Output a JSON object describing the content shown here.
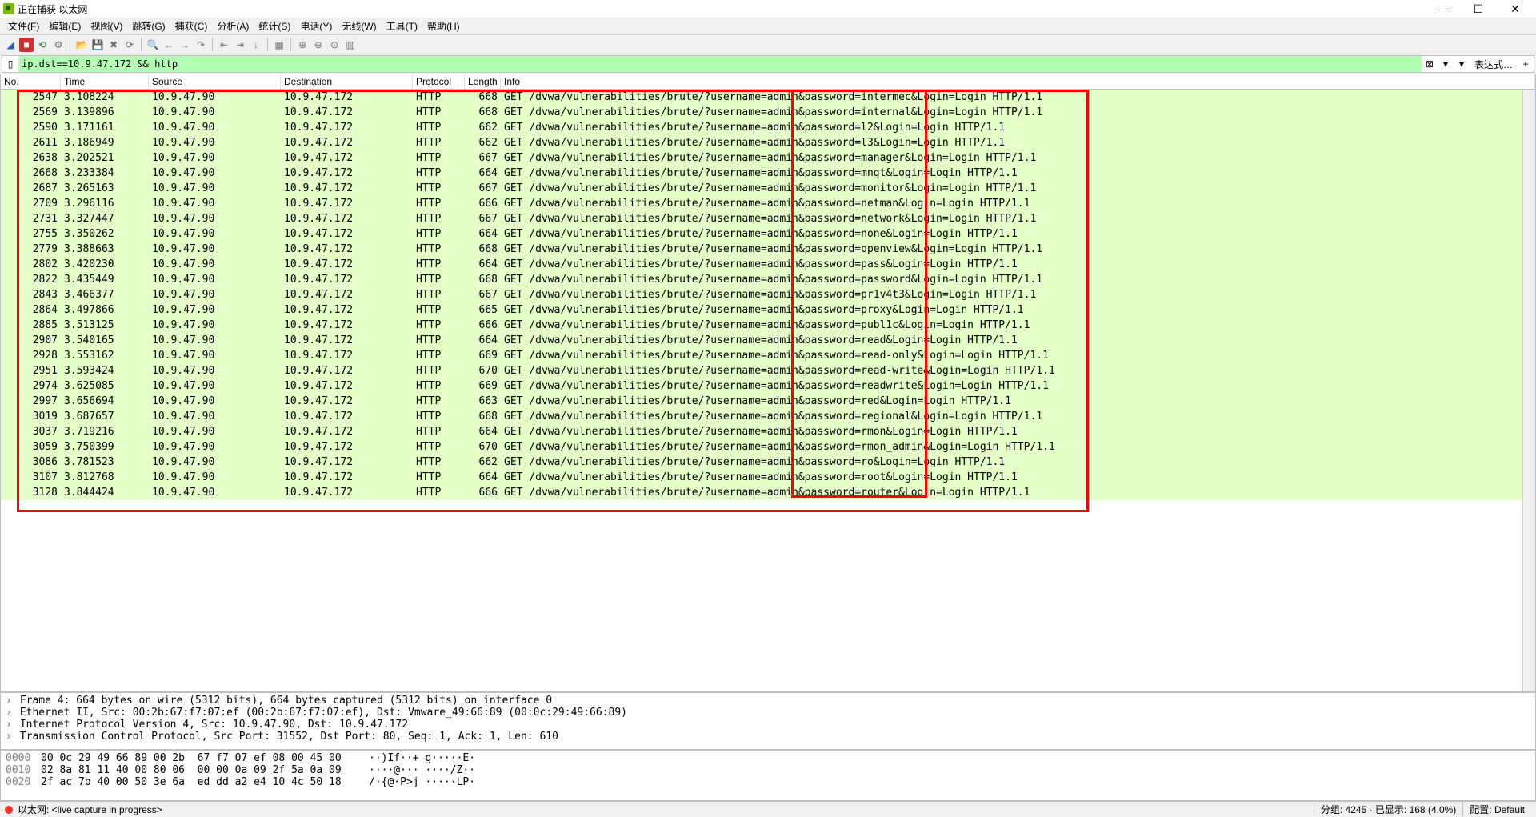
{
  "window": {
    "title": "正在捕获 以太网"
  },
  "menu": {
    "file": "文件(F)",
    "edit": "编辑(E)",
    "view": "视图(V)",
    "go": "跳转(G)",
    "capture": "捕获(C)",
    "analyze": "分析(A)",
    "stats": "统计(S)",
    "telephony": "电话(Y)",
    "wireless": "无线(W)",
    "tools": "工具(T)",
    "help": "帮助(H)"
  },
  "filter": {
    "value": "ip.dst==10.9.47.172 && http",
    "expr": "表达式…",
    "plus": "+"
  },
  "columns": {
    "no": "No.",
    "time": "Time",
    "source": "Source",
    "dest": "Destination",
    "proto": "Protocol",
    "len": "Length",
    "info": "Info"
  },
  "col_widths": {
    "no": 75,
    "time": 110,
    "source": 165,
    "dest": 165,
    "proto": 65,
    "len": 45,
    "info": 880
  },
  "packets": [
    {
      "no": "2547",
      "time": "3.108224",
      "src": "10.9.47.90",
      "dst": "10.9.47.172",
      "proto": "HTTP",
      "len": "668",
      "info": "GET /dvwa/vulnerabilities/brute/?username=admin&password=intermec&Login=Login HTTP/1.1"
    },
    {
      "no": "2569",
      "time": "3.139896",
      "src": "10.9.47.90",
      "dst": "10.9.47.172",
      "proto": "HTTP",
      "len": "668",
      "info": "GET /dvwa/vulnerabilities/brute/?username=admin&password=internal&Login=Login HTTP/1.1"
    },
    {
      "no": "2590",
      "time": "3.171161",
      "src": "10.9.47.90",
      "dst": "10.9.47.172",
      "proto": "HTTP",
      "len": "662",
      "info": "GET /dvwa/vulnerabilities/brute/?username=admin&password=l2&Login=Login HTTP/1.1"
    },
    {
      "no": "2611",
      "time": "3.186949",
      "src": "10.9.47.90",
      "dst": "10.9.47.172",
      "proto": "HTTP",
      "len": "662",
      "info": "GET /dvwa/vulnerabilities/brute/?username=admin&password=l3&Login=Login HTTP/1.1"
    },
    {
      "no": "2638",
      "time": "3.202521",
      "src": "10.9.47.90",
      "dst": "10.9.47.172",
      "proto": "HTTP",
      "len": "667",
      "info": "GET /dvwa/vulnerabilities/brute/?username=admin&password=manager&Login=Login HTTP/1.1"
    },
    {
      "no": "2668",
      "time": "3.233384",
      "src": "10.9.47.90",
      "dst": "10.9.47.172",
      "proto": "HTTP",
      "len": "664",
      "info": "GET /dvwa/vulnerabilities/brute/?username=admin&password=mngt&Login=Login HTTP/1.1"
    },
    {
      "no": "2687",
      "time": "3.265163",
      "src": "10.9.47.90",
      "dst": "10.9.47.172",
      "proto": "HTTP",
      "len": "667",
      "info": "GET /dvwa/vulnerabilities/brute/?username=admin&password=monitor&Login=Login HTTP/1.1"
    },
    {
      "no": "2709",
      "time": "3.296116",
      "src": "10.9.47.90",
      "dst": "10.9.47.172",
      "proto": "HTTP",
      "len": "666",
      "info": "GET /dvwa/vulnerabilities/brute/?username=admin&password=netman&Login=Login HTTP/1.1"
    },
    {
      "no": "2731",
      "time": "3.327447",
      "src": "10.9.47.90",
      "dst": "10.9.47.172",
      "proto": "HTTP",
      "len": "667",
      "info": "GET /dvwa/vulnerabilities/brute/?username=admin&password=network&Login=Login HTTP/1.1"
    },
    {
      "no": "2755",
      "time": "3.350262",
      "src": "10.9.47.90",
      "dst": "10.9.47.172",
      "proto": "HTTP",
      "len": "664",
      "info": "GET /dvwa/vulnerabilities/brute/?username=admin&password=none&Login=Login HTTP/1.1"
    },
    {
      "no": "2779",
      "time": "3.388663",
      "src": "10.9.47.90",
      "dst": "10.9.47.172",
      "proto": "HTTP",
      "len": "668",
      "info": "GET /dvwa/vulnerabilities/brute/?username=admin&password=openview&Login=Login HTTP/1.1"
    },
    {
      "no": "2802",
      "time": "3.420230",
      "src": "10.9.47.90",
      "dst": "10.9.47.172",
      "proto": "HTTP",
      "len": "664",
      "info": "GET /dvwa/vulnerabilities/brute/?username=admin&password=pass&Login=Login HTTP/1.1"
    },
    {
      "no": "2822",
      "time": "3.435449",
      "src": "10.9.47.90",
      "dst": "10.9.47.172",
      "proto": "HTTP",
      "len": "668",
      "info": "GET /dvwa/vulnerabilities/brute/?username=admin&password=password&Login=Login HTTP/1.1"
    },
    {
      "no": "2843",
      "time": "3.466377",
      "src": "10.9.47.90",
      "dst": "10.9.47.172",
      "proto": "HTTP",
      "len": "667",
      "info": "GET /dvwa/vulnerabilities/brute/?username=admin&password=pr1v4t3&Login=Login HTTP/1.1"
    },
    {
      "no": "2864",
      "time": "3.497866",
      "src": "10.9.47.90",
      "dst": "10.9.47.172",
      "proto": "HTTP",
      "len": "665",
      "info": "GET /dvwa/vulnerabilities/brute/?username=admin&password=proxy&Login=Login HTTP/1.1"
    },
    {
      "no": "2885",
      "time": "3.513125",
      "src": "10.9.47.90",
      "dst": "10.9.47.172",
      "proto": "HTTP",
      "len": "666",
      "info": "GET /dvwa/vulnerabilities/brute/?username=admin&password=publ1c&Login=Login HTTP/1.1"
    },
    {
      "no": "2907",
      "time": "3.540165",
      "src": "10.9.47.90",
      "dst": "10.9.47.172",
      "proto": "HTTP",
      "len": "664",
      "info": "GET /dvwa/vulnerabilities/brute/?username=admin&password=read&Login=Login HTTP/1.1"
    },
    {
      "no": "2928",
      "time": "3.553162",
      "src": "10.9.47.90",
      "dst": "10.9.47.172",
      "proto": "HTTP",
      "len": "669",
      "info": "GET /dvwa/vulnerabilities/brute/?username=admin&password=read-only&Login=Login HTTP/1.1"
    },
    {
      "no": "2951",
      "time": "3.593424",
      "src": "10.9.47.90",
      "dst": "10.9.47.172",
      "proto": "HTTP",
      "len": "670",
      "info": "GET /dvwa/vulnerabilities/brute/?username=admin&password=read-write&Login=Login HTTP/1.1"
    },
    {
      "no": "2974",
      "time": "3.625085",
      "src": "10.9.47.90",
      "dst": "10.9.47.172",
      "proto": "HTTP",
      "len": "669",
      "info": "GET /dvwa/vulnerabilities/brute/?username=admin&password=readwrite&Login=Login HTTP/1.1"
    },
    {
      "no": "2997",
      "time": "3.656694",
      "src": "10.9.47.90",
      "dst": "10.9.47.172",
      "proto": "HTTP",
      "len": "663",
      "info": "GET /dvwa/vulnerabilities/brute/?username=admin&password=red&Login=Login HTTP/1.1"
    },
    {
      "no": "3019",
      "time": "3.687657",
      "src": "10.9.47.90",
      "dst": "10.9.47.172",
      "proto": "HTTP",
      "len": "668",
      "info": "GET /dvwa/vulnerabilities/brute/?username=admin&password=regional&Login=Login HTTP/1.1"
    },
    {
      "no": "3037",
      "time": "3.719216",
      "src": "10.9.47.90",
      "dst": "10.9.47.172",
      "proto": "HTTP",
      "len": "664",
      "info": "GET /dvwa/vulnerabilities/brute/?username=admin&password=rmon&Login=Login HTTP/1.1"
    },
    {
      "no": "3059",
      "time": "3.750399",
      "src": "10.9.47.90",
      "dst": "10.9.47.172",
      "proto": "HTTP",
      "len": "670",
      "info": "GET /dvwa/vulnerabilities/brute/?username=admin&password=rmon_admin&Login=Login HTTP/1.1"
    },
    {
      "no": "3086",
      "time": "3.781523",
      "src": "10.9.47.90",
      "dst": "10.9.47.172",
      "proto": "HTTP",
      "len": "662",
      "info": "GET /dvwa/vulnerabilities/brute/?username=admin&password=ro&Login=Login HTTP/1.1"
    },
    {
      "no": "3107",
      "time": "3.812768",
      "src": "10.9.47.90",
      "dst": "10.9.47.172",
      "proto": "HTTP",
      "len": "664",
      "info": "GET /dvwa/vulnerabilities/brute/?username=admin&password=root&Login=Login HTTP/1.1"
    },
    {
      "no": "3128",
      "time": "3.844424",
      "src": "10.9.47.90",
      "dst": "10.9.47.172",
      "proto": "HTTP",
      "len": "666",
      "info": "GET /dvwa/vulnerabilities/brute/?username=admin&password=router&Login=Login HTTP/1.1"
    }
  ],
  "tree": [
    "Frame 4: 664 bytes on wire (5312 bits), 664 bytes captured (5312 bits) on interface 0",
    "Ethernet II, Src: 00:2b:67:f7:07:ef (00:2b:67:f7:07:ef), Dst: Vmware_49:66:89 (00:0c:29:49:66:89)",
    "Internet Protocol Version 4, Src: 10.9.47.90, Dst: 10.9.47.172",
    "Transmission Control Protocol, Src Port: 31552, Dst Port: 80, Seq: 1, Ack: 1, Len: 610"
  ],
  "hex": [
    {
      "off": "0000",
      "bytes": "00 0c 29 49 66 89 00 2b  67 f7 07 ef 08 00 45 00",
      "ascii": "··)If··+ g·····E·"
    },
    {
      "off": "0010",
      "bytes": "02 8a 81 11 40 00 80 06  00 00 0a 09 2f 5a 0a 09",
      "ascii": "····@··· ····/Z··"
    },
    {
      "off": "0020",
      "bytes": "2f ac 7b 40 00 50 3e 6a  ed dd a2 e4 10 4c 50 18",
      "ascii": "/·{@·P>j ·····LP·"
    }
  ],
  "status": {
    "iface": "以太网: <live capture in progress>",
    "packets": "分组: 4245 · 已显示: 168 (4.0%)",
    "profile": "配置: Default"
  }
}
